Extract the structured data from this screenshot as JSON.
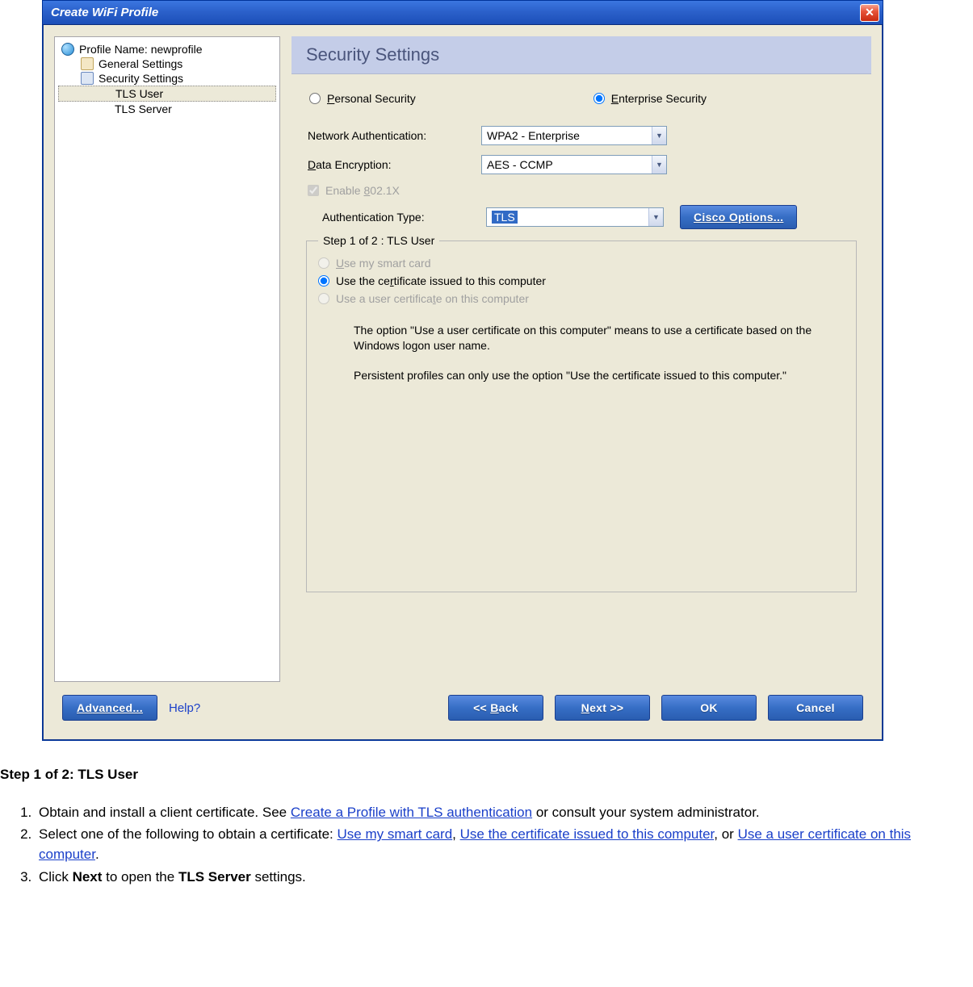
{
  "window": {
    "title": "Create WiFi Profile",
    "close_label": "X"
  },
  "tree": {
    "profile_label": "Profile Name: newprofile",
    "general": "General Settings",
    "security": "Security Settings",
    "tls_user": "TLS User",
    "tls_server": "TLS Server"
  },
  "panel": {
    "header": "Security Settings"
  },
  "radios": {
    "personal": "Personal Security",
    "enterprise": "Enterprise Security"
  },
  "fields": {
    "network_auth_label": "Network Authentication:",
    "network_auth_value": "WPA2 - Enterprise",
    "data_enc_label": "Data Encryption:",
    "data_enc_value": "AES - CCMP",
    "enable_8021x": "Enable 802.1X",
    "auth_type_label": "Authentication Type:",
    "auth_type_value": "TLS"
  },
  "cisco_button": "Cisco Options...",
  "step": {
    "legend": "Step 1 of 2 : TLS User",
    "opt_smartcard": "Use my smart card",
    "opt_cert_computer": "Use the certificate issued to this computer",
    "opt_user_cert": "Use a user certificate on this computer",
    "note1": "The option \"Use a user certificate on this computer\" means to use a certificate based on the Windows logon user name.",
    "note2": "Persistent profiles can only use the option \"Use the certificate issued to this computer.\""
  },
  "buttons": {
    "advanced": "Advanced...",
    "help": "Help?",
    "back": "<< Back",
    "next": "Next >>",
    "ok": "OK",
    "cancel": "Cancel"
  },
  "doc": {
    "heading": "Step 1 of 2: TLS User",
    "li1_a": "Obtain and install a client certificate. See ",
    "li1_link": "Create a Profile with TLS authentication",
    "li1_b": " or consult your system administrator.",
    "li2_a": "Select one of the following to obtain a certificate: ",
    "li2_link1": "Use my smart card",
    "li2_sep1": ", ",
    "li2_link2": "Use the certificate issued to this computer",
    "li2_sep2": ", or ",
    "li2_link3": "Use a user certificate on this computer",
    "li2_end": ".",
    "li3_a": "Click ",
    "li3_b1": "Next",
    "li3_c": " to open the ",
    "li3_b2": "TLS Server",
    "li3_d": " settings."
  }
}
